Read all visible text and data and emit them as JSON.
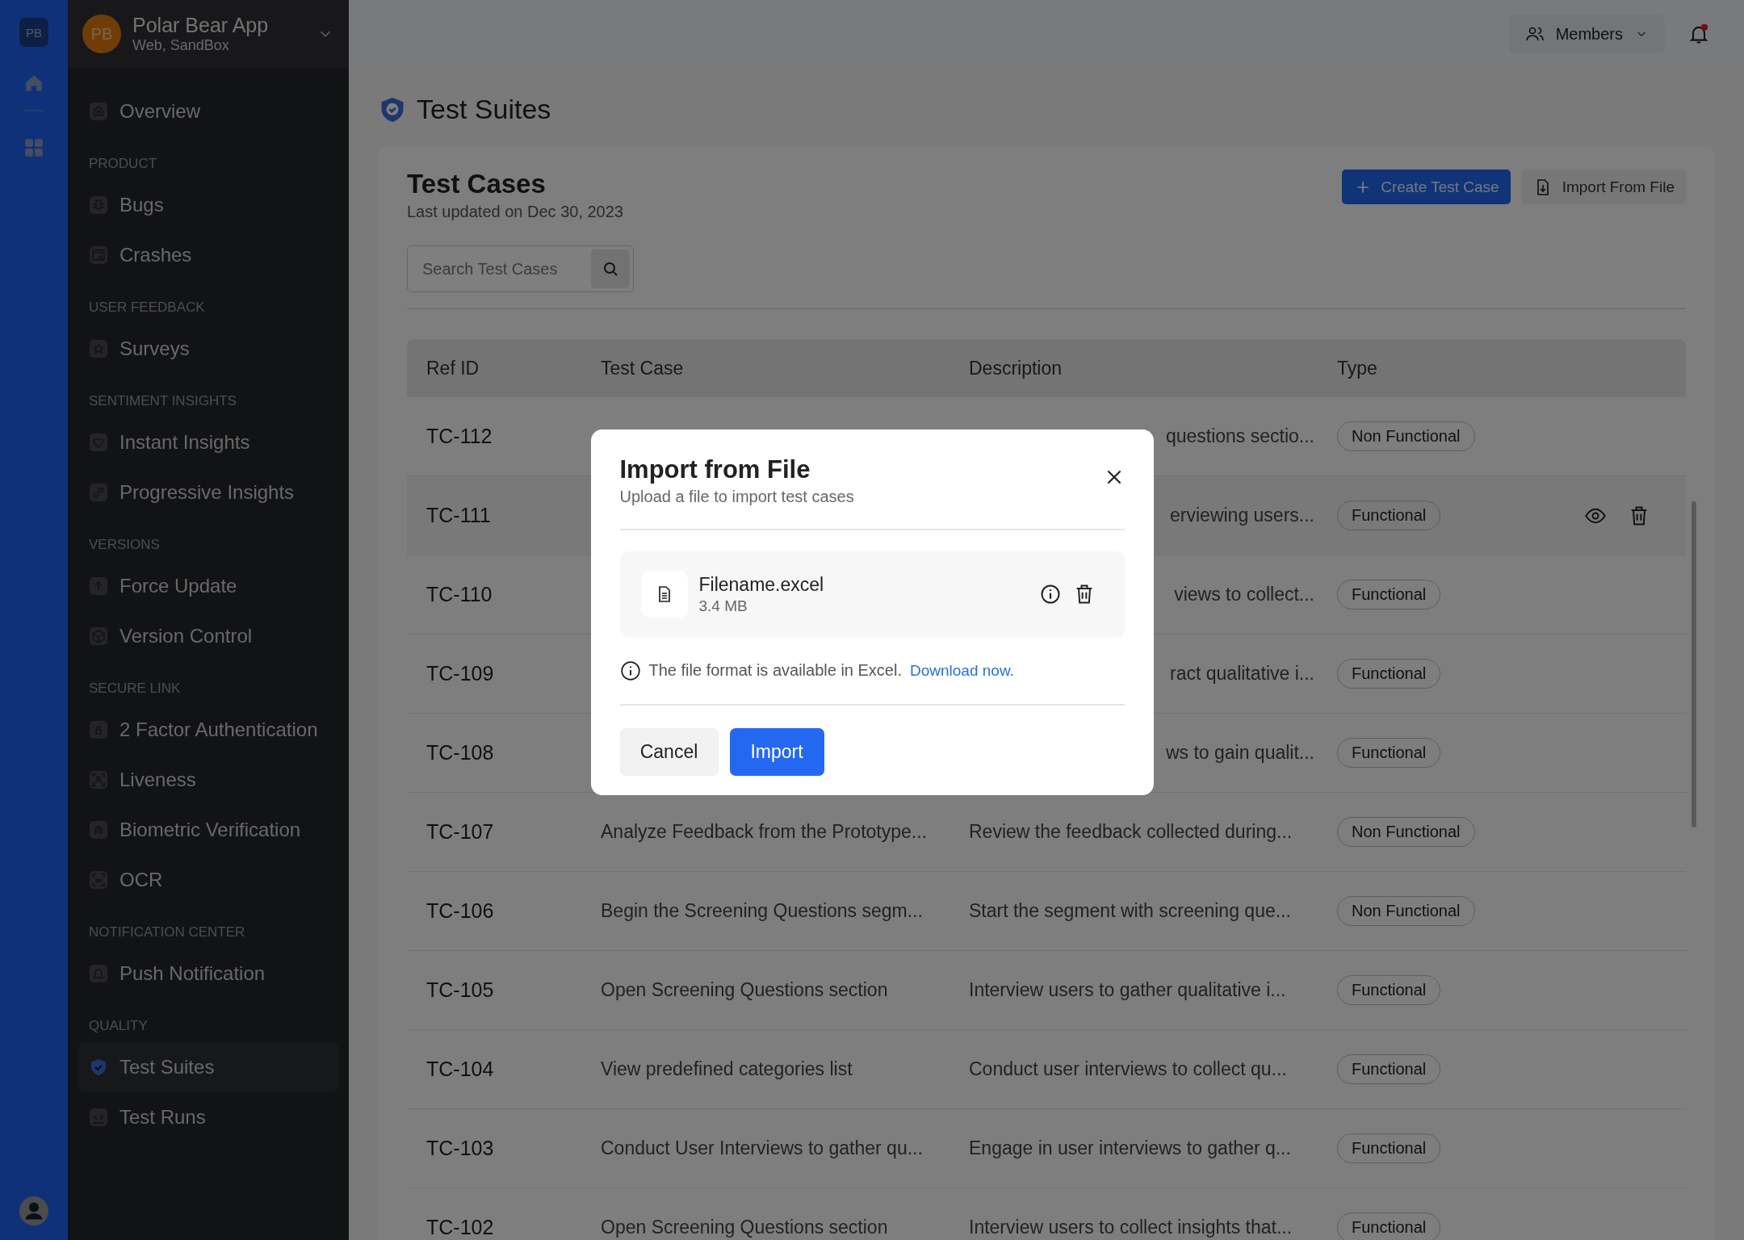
{
  "rail": {
    "logo": "PB"
  },
  "app": {
    "initials": "PB",
    "name": "Polar Bear App",
    "env": "Web, SandBox"
  },
  "sidebar": {
    "sections": [
      {
        "items": [
          {
            "label": "Overview",
            "selected": false
          }
        ]
      },
      {
        "heading": "PRODUCT",
        "items": [
          {
            "label": "Bugs",
            "selected": false
          },
          {
            "label": "Crashes",
            "selected": false
          }
        ]
      },
      {
        "heading": "USER FEEDBACK",
        "items": [
          {
            "label": "Surveys",
            "selected": false
          }
        ]
      },
      {
        "heading": "SENTIMENT INSIGHTS",
        "items": [
          {
            "label": "Instant Insights",
            "selected": false
          },
          {
            "label": "Progressive Insights",
            "selected": false
          }
        ]
      },
      {
        "heading": "VERSIONS",
        "items": [
          {
            "label": "Force Update",
            "selected": false
          },
          {
            "label": "Version Control",
            "selected": false
          }
        ]
      },
      {
        "heading": "SECURE LINK",
        "items": [
          {
            "label": "2 Factor Authentication",
            "selected": false
          },
          {
            "label": "Liveness",
            "selected": false
          },
          {
            "label": "Biometric Verification",
            "selected": false
          },
          {
            "label": "OCR",
            "selected": false
          }
        ]
      },
      {
        "heading": "NOTIFICATION CENTER",
        "items": [
          {
            "label": "Push Notification",
            "selected": false
          }
        ]
      },
      {
        "heading": "QUALITY",
        "items": [
          {
            "label": "Test Suites",
            "selected": true
          },
          {
            "label": "Test Runs",
            "selected": false
          }
        ]
      }
    ]
  },
  "topbar": {
    "members": "Members",
    "unread": true
  },
  "page_title": "Test Suites",
  "card": {
    "title": "Test Cases",
    "subtitle": "Last updated on Dec 30, 2023",
    "create_button": "Create Test Case",
    "import_button": "Import From File",
    "search": {
      "placeholder": "Search Test Cases"
    }
  },
  "table": {
    "columns": [
      "Ref ID",
      "Test Case",
      "Description",
      "Type"
    ],
    "rows": [
      {
        "ref": "TC-112",
        "description": "questions sectio...",
        "description_partial": true,
        "type": "Non Functional",
        "hovered": false
      },
      {
        "ref": "TC-111",
        "description": "erviewing users...",
        "description_partial": true,
        "type": "Functional",
        "hovered": true
      },
      {
        "ref": "TC-110",
        "description": "views to collect...",
        "description_partial": true,
        "type": "Functional",
        "hovered": false
      },
      {
        "ref": "TC-109",
        "description": "ract qualitative i...",
        "description_partial": true,
        "type": "Functional",
        "hovered": false
      },
      {
        "ref": "TC-108",
        "description": "ws to gain qualit...",
        "description_partial": true,
        "type": "Functional",
        "hovered": false
      },
      {
        "ref": "TC-107",
        "test_case": "Analyze Feedback from the Prototype...",
        "description": "Review the feedback collected during...",
        "description_partial": false,
        "type": "Non Functional",
        "hovered": false
      },
      {
        "ref": "TC-106",
        "test_case": "Begin the Screening Questions segm...",
        "description": "Start the segment with screening que...",
        "description_partial": false,
        "type": "Non Functional",
        "hovered": false
      },
      {
        "ref": "TC-105",
        "test_case": "Open Screening Questions section",
        "description": "Interview users to gather qualitative i...",
        "description_partial": false,
        "type": "Functional",
        "hovered": false
      },
      {
        "ref": "TC-104",
        "test_case": "View predefined categories list",
        "description": "Conduct user interviews to collect qu...",
        "description_partial": false,
        "type": "Functional",
        "hovered": false
      },
      {
        "ref": "TC-103",
        "test_case": "Conduct User Interviews to gather qu...",
        "description": "Engage in user interviews to gather q...",
        "description_partial": false,
        "type": "Functional",
        "hovered": false
      },
      {
        "ref": "TC-102",
        "test_case": "Open Screening Questions section",
        "description": "Interview users to collect insights that...",
        "description_partial": false,
        "type": "Functional",
        "hovered": false
      }
    ]
  },
  "modal": {
    "title": "Import from File",
    "subtitle": "Upload a file to import test cases",
    "file": {
      "name": "Filename.excel",
      "size": "3.4 MB"
    },
    "note": "The file format is available in Excel.",
    "link": "Download now.",
    "cancel": "Cancel",
    "confirm": "Import"
  }
}
